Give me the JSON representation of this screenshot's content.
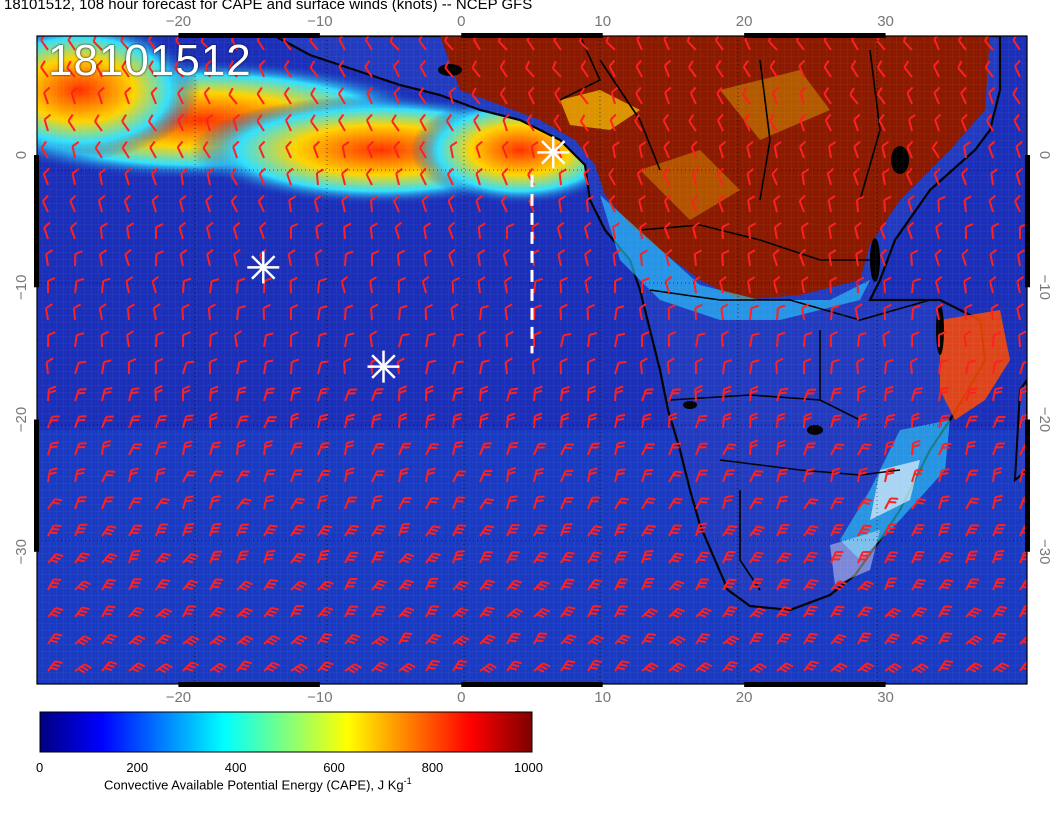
{
  "title": "18101512, 108 hour forecast for CAPE and surface winds (knots) -- NCEP GFS",
  "stamp": "18101512",
  "map": {
    "lon_range": [
      -30,
      40
    ],
    "lat_range": [
      -40,
      9
    ],
    "lon_ticks": [
      "−20",
      "−10",
      "0",
      "10",
      "20",
      "30"
    ],
    "lat_ticks": [
      "0",
      "−10",
      "−20",
      "−30"
    ],
    "ocean_color": "#1b2fb8",
    "land_color": "#8b1a00"
  },
  "markers": [
    {
      "name": "star-west",
      "lon": -14,
      "lat": -8.5
    },
    {
      "name": "star-south",
      "lon": -5.5,
      "lat": -16
    },
    {
      "name": "star-gulf",
      "lon": 6.5,
      "lat": 0.2
    }
  ],
  "dashed_line": {
    "lon": 5,
    "lat_start": -1.5,
    "lat_end": -15
  },
  "colorbar": {
    "label": "Convective Available Potential Energy (CAPE), J Kg",
    "label_sup": "-1",
    "ticks": [
      "0",
      "200",
      "400",
      "600",
      "800",
      "1000"
    ],
    "colors": [
      "#00007f",
      "#0000ff",
      "#007fff",
      "#00ffff",
      "#7fff7f",
      "#ffff00",
      "#ff7f00",
      "#ff0000",
      "#7f0000"
    ]
  }
}
